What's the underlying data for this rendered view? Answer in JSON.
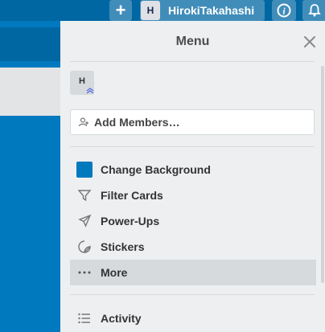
{
  "header": {
    "add_label": "+",
    "user_initial": "H",
    "user_name": "HirokiTakahashi",
    "info_icon": "info-icon",
    "bell_icon": "bell-icon"
  },
  "menu": {
    "title": "Menu",
    "close_icon": "close-icon",
    "member_initial": "H",
    "add_members_label": "Add Members…",
    "items": [
      {
        "label": "Change Background",
        "icon": "color-swatch"
      },
      {
        "label": "Filter Cards",
        "icon": "filter-icon"
      },
      {
        "label": "Power-Ups",
        "icon": "rocket-icon"
      },
      {
        "label": "Stickers",
        "icon": "sticker-icon"
      },
      {
        "label": "More",
        "icon": "more-icon"
      }
    ],
    "activity_label": "Activity"
  },
  "colors": {
    "board_blue": "#0079bf",
    "header_blue": "#0067a3",
    "menu_bg": "#edeff0",
    "active_item": "#d6dadc"
  }
}
